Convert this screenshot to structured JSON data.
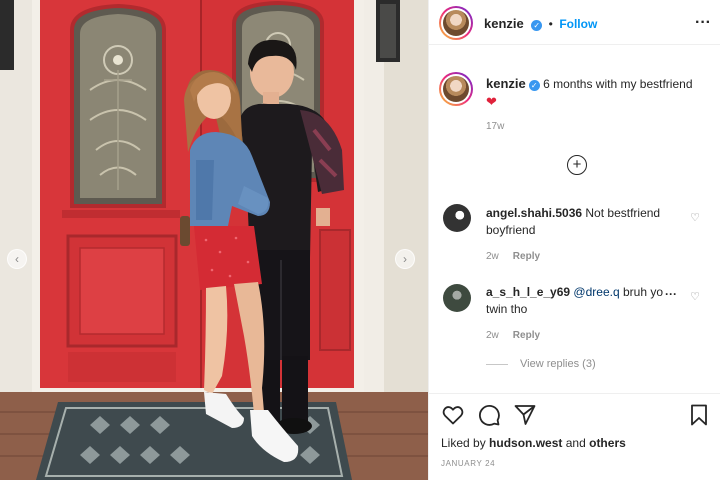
{
  "header": {
    "username": "kenzie",
    "verified_badge": "✓",
    "separator": "•",
    "follow_label": "Follow",
    "more_label": "···"
  },
  "caption": {
    "username": "kenzie",
    "text": "6 months with my bestfriend",
    "emoji": "❤",
    "age": "17w"
  },
  "load_more_icon": "+",
  "comments": [
    {
      "username": "angel.shahi.5036",
      "text": "Not bestfriend boyfriend",
      "age": "2w",
      "reply_label": "Reply",
      "like_icon": "heart-outline-icon"
    },
    {
      "username": "a_s_h_l_e_y69",
      "mention": "@dree.q",
      "text": "bruh yo",
      "text_cont": "twin tho",
      "age": "2w",
      "reply_label": "Reply",
      "view_replies": "View replies (3)",
      "like_icon": "heart-outline-icon"
    }
  ],
  "likes": {
    "prefix": "Liked by",
    "user": "hudson.west",
    "middle": "and",
    "suffix": "others"
  },
  "post_date": "JANUARY 24",
  "carousel": {
    "prev": "‹",
    "next": "›"
  },
  "colors": {
    "accent": "#0095f6",
    "door": "#d8363a",
    "heart": "#e0223b",
    "muted": "#8e8e8e"
  }
}
